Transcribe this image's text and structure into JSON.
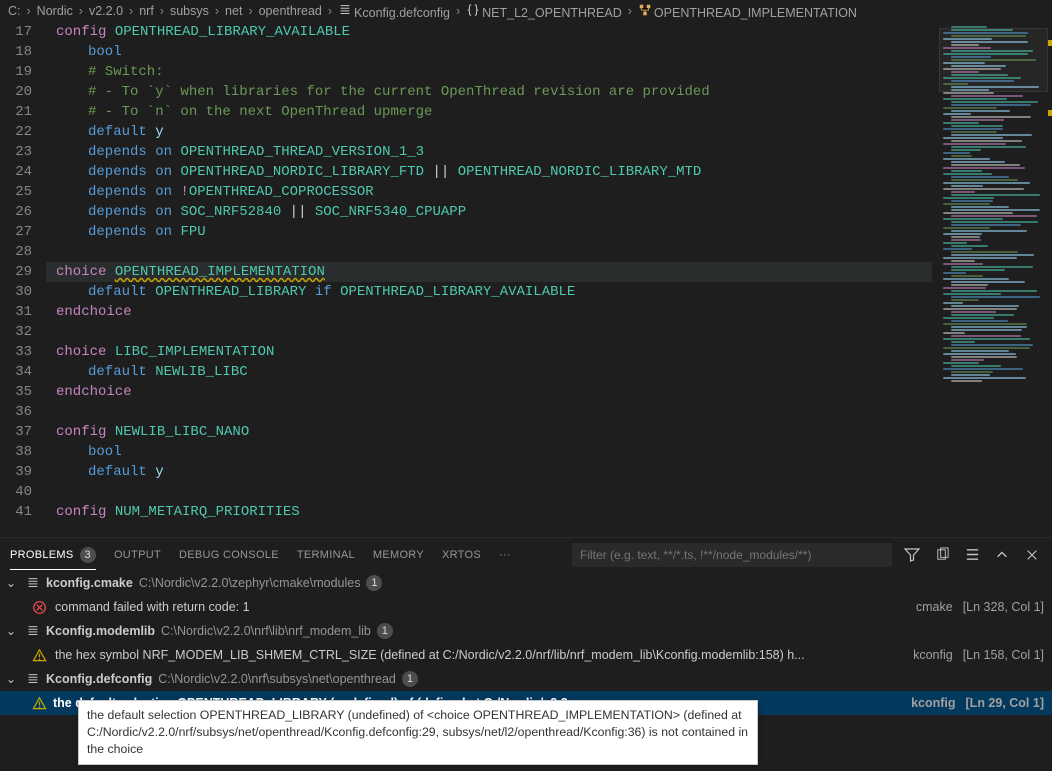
{
  "breadcrumb": [
    "C:",
    "Nordic",
    "v2.2.0",
    "nrf",
    "subsys",
    "net",
    "openthread",
    "Kconfig.defconfig",
    "NET_L2_OPENTHREAD",
    "OPENTHREAD_IMPLEMENTATION"
  ],
  "breadcrumb_icons": [
    "",
    "",
    "",
    "",
    "",
    "",
    "",
    "list",
    "braces",
    "struct"
  ],
  "code_start_line": 17,
  "code_lines": [
    {
      "t": [
        [
          "kw1",
          "config "
        ],
        [
          "sym",
          "OPENTHREAD_LIBRARY_AVAILABLE"
        ]
      ]
    },
    {
      "i": 2,
      "t": [
        [
          "kw2",
          "bool"
        ]
      ]
    },
    {
      "i": 2,
      "t": [
        [
          "cmt",
          "# Switch:"
        ]
      ]
    },
    {
      "i": 2,
      "t": [
        [
          "cmt",
          "# - To `y` when libraries for the current OpenThread revision are provided"
        ]
      ]
    },
    {
      "i": 2,
      "t": [
        [
          "cmt",
          "# - To `n` on the next OpenThread upmerge"
        ]
      ]
    },
    {
      "i": 2,
      "t": [
        [
          "kw2",
          "default "
        ],
        [
          "lit",
          "y"
        ]
      ]
    },
    {
      "i": 2,
      "t": [
        [
          "kw2",
          "depends "
        ],
        [
          "kw2",
          "on "
        ],
        [
          "sym",
          "OPENTHREAD_THREAD_VERSION_1_3"
        ]
      ]
    },
    {
      "i": 2,
      "t": [
        [
          "kw2",
          "depends "
        ],
        [
          "kw2",
          "on "
        ],
        [
          "sym",
          "OPENTHREAD_NORDIC_LIBRARY_FTD"
        ],
        [
          "op",
          " || "
        ],
        [
          "sym",
          "OPENTHREAD_NORDIC_LIBRARY_MTD"
        ]
      ]
    },
    {
      "i": 2,
      "t": [
        [
          "kw2",
          "depends "
        ],
        [
          "kw2",
          "on "
        ],
        [
          "excl",
          "!"
        ],
        [
          "sym",
          "OPENTHREAD_COPROCESSOR"
        ]
      ]
    },
    {
      "i": 2,
      "t": [
        [
          "kw2",
          "depends "
        ],
        [
          "kw2",
          "on "
        ],
        [
          "sym",
          "SOC_NRF52840"
        ],
        [
          "op",
          " || "
        ],
        [
          "sym",
          "SOC_NRF5340_CPUAPP"
        ]
      ]
    },
    {
      "i": 2,
      "t": [
        [
          "kw2",
          "depends "
        ],
        [
          "kw2",
          "on "
        ],
        [
          "sym",
          "FPU"
        ]
      ]
    },
    {
      "t": []
    },
    {
      "hl": true,
      "t": [
        [
          "kw1",
          "choice "
        ],
        [
          "sym wavy",
          "OPENTHREAD_IMPLEMENTATION"
        ]
      ]
    },
    {
      "i": 2,
      "t": [
        [
          "kw2",
          "default "
        ],
        [
          "sym",
          "OPENTHREAD_LIBRARY"
        ],
        [
          "kw2",
          " if "
        ],
        [
          "sym",
          "OPENTHREAD_LIBRARY_AVAILABLE"
        ]
      ]
    },
    {
      "t": [
        [
          "kw1",
          "endchoice"
        ]
      ]
    },
    {
      "t": []
    },
    {
      "t": [
        [
          "kw1",
          "choice "
        ],
        [
          "sym",
          "LIBC_IMPLEMENTATION"
        ]
      ]
    },
    {
      "i": 2,
      "t": [
        [
          "kw2",
          "default "
        ],
        [
          "sym",
          "NEWLIB_LIBC"
        ]
      ]
    },
    {
      "t": [
        [
          "kw1",
          "endchoice"
        ]
      ]
    },
    {
      "t": []
    },
    {
      "t": [
        [
          "kw1",
          "config "
        ],
        [
          "sym",
          "NEWLIB_LIBC_NANO"
        ]
      ]
    },
    {
      "i": 2,
      "t": [
        [
          "kw2",
          "bool"
        ]
      ]
    },
    {
      "i": 2,
      "t": [
        [
          "kw2",
          "default "
        ],
        [
          "lit",
          "y"
        ]
      ]
    },
    {
      "t": []
    },
    {
      "t": [
        [
          "kw1",
          "config "
        ],
        [
          "sym",
          "NUM_METAIRQ_PRIORITIES"
        ]
      ]
    }
  ],
  "panel": {
    "tabs": [
      "PROBLEMS",
      "OUTPUT",
      "DEBUG CONSOLE",
      "TERMINAL",
      "MEMORY",
      "XRTOS"
    ],
    "problems_count": "3",
    "filter_placeholder": "Filter (e.g. text, **/*.ts, !**/node_modules/**)"
  },
  "problems": [
    {
      "file": "kconfig.cmake",
      "path": "C:\\Nordic\\v2.2.0\\zephyr\\cmake\\modules",
      "count": "1",
      "items": [
        {
          "sev": "error",
          "msg": "command failed with return code: 1",
          "src": "cmake",
          "loc": "[Ln 328, Col 1]"
        }
      ]
    },
    {
      "file": "Kconfig.modemlib",
      "path": "C:\\Nordic\\v2.2.0\\nrf\\lib\\nrf_modem_lib",
      "count": "1",
      "items": [
        {
          "sev": "warning",
          "msg": "the hex symbol NRF_MODEM_LIB_SHMEM_CTRL_SIZE (defined at C:/Nordic/v2.2.0/nrf/lib/nrf_modem_lib\\Kconfig.modemlib:158) h...",
          "src": "kconfig",
          "loc": "[Ln 158, Col 1]"
        }
      ]
    },
    {
      "file": "Kconfig.defconfig",
      "path": "C:\\Nordic\\v2.2.0\\nrf\\subsys\\net\\openthread",
      "count": "1",
      "items": [
        {
          "sev": "warning",
          "sel": true,
          "msg": "the default selection OPENTHREAD_LIBRARY (undefined) of <choice OPENTHREAD_IMPLEMENTATION> (defined at C:/Nordic/v2.2....",
          "src": "kconfig",
          "loc": "[Ln 29, Col 1]"
        }
      ]
    }
  ],
  "tooltip": "the default selection OPENTHREAD_LIBRARY (undefined) of <choice OPENTHREAD_IMPLEMENTATION> (defined at C:/Nordic/v2.2.0/nrf/subsys/net/openthread/Kconfig.defconfig:29, subsys/net/l2/openthread/Kconfig:36) is not contained in the choice"
}
